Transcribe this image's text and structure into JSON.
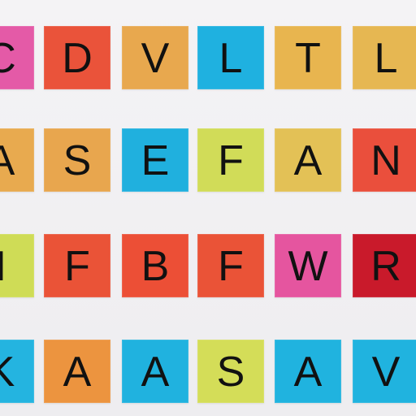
{
  "rows": [
    [
      {
        "letter": "C",
        "color": "#e45aa7"
      },
      {
        "letter": "D",
        "color": "#ea533a"
      },
      {
        "letter": "V",
        "color": "#e8a84e"
      },
      {
        "letter": "L",
        "color": "#1fb1e0"
      },
      {
        "letter": "T",
        "color": "#e8b54f"
      },
      {
        "letter": "L",
        "color": "#e6b752"
      }
    ],
    [
      {
        "letter": "A",
        "color": "#e8aa4f"
      },
      {
        "letter": "S",
        "color": "#e8a64e"
      },
      {
        "letter": "E",
        "color": "#20b0de"
      },
      {
        "letter": "F",
        "color": "#d1dc58"
      },
      {
        "letter": "A",
        "color": "#e3c156"
      },
      {
        "letter": "N",
        "color": "#ea4f3c"
      }
    ],
    [
      {
        "letter": "I",
        "color": "#cfdc56"
      },
      {
        "letter": "F",
        "color": "#ea5337"
      },
      {
        "letter": "B",
        "color": "#ec4f36"
      },
      {
        "letter": "F",
        "color": "#ea5337"
      },
      {
        "letter": "W",
        "color": "#e5559f"
      },
      {
        "letter": "R",
        "color": "#c91a2b"
      }
    ],
    [
      {
        "letter": "K",
        "color": "#24b4e0"
      },
      {
        "letter": "A",
        "color": "#ec943f"
      },
      {
        "letter": "A",
        "color": "#20b2df"
      },
      {
        "letter": "S",
        "color": "#d4dd58"
      },
      {
        "letter": "A",
        "color": "#20b3df"
      },
      {
        "letter": "V",
        "color": "#20b3df"
      }
    ]
  ]
}
